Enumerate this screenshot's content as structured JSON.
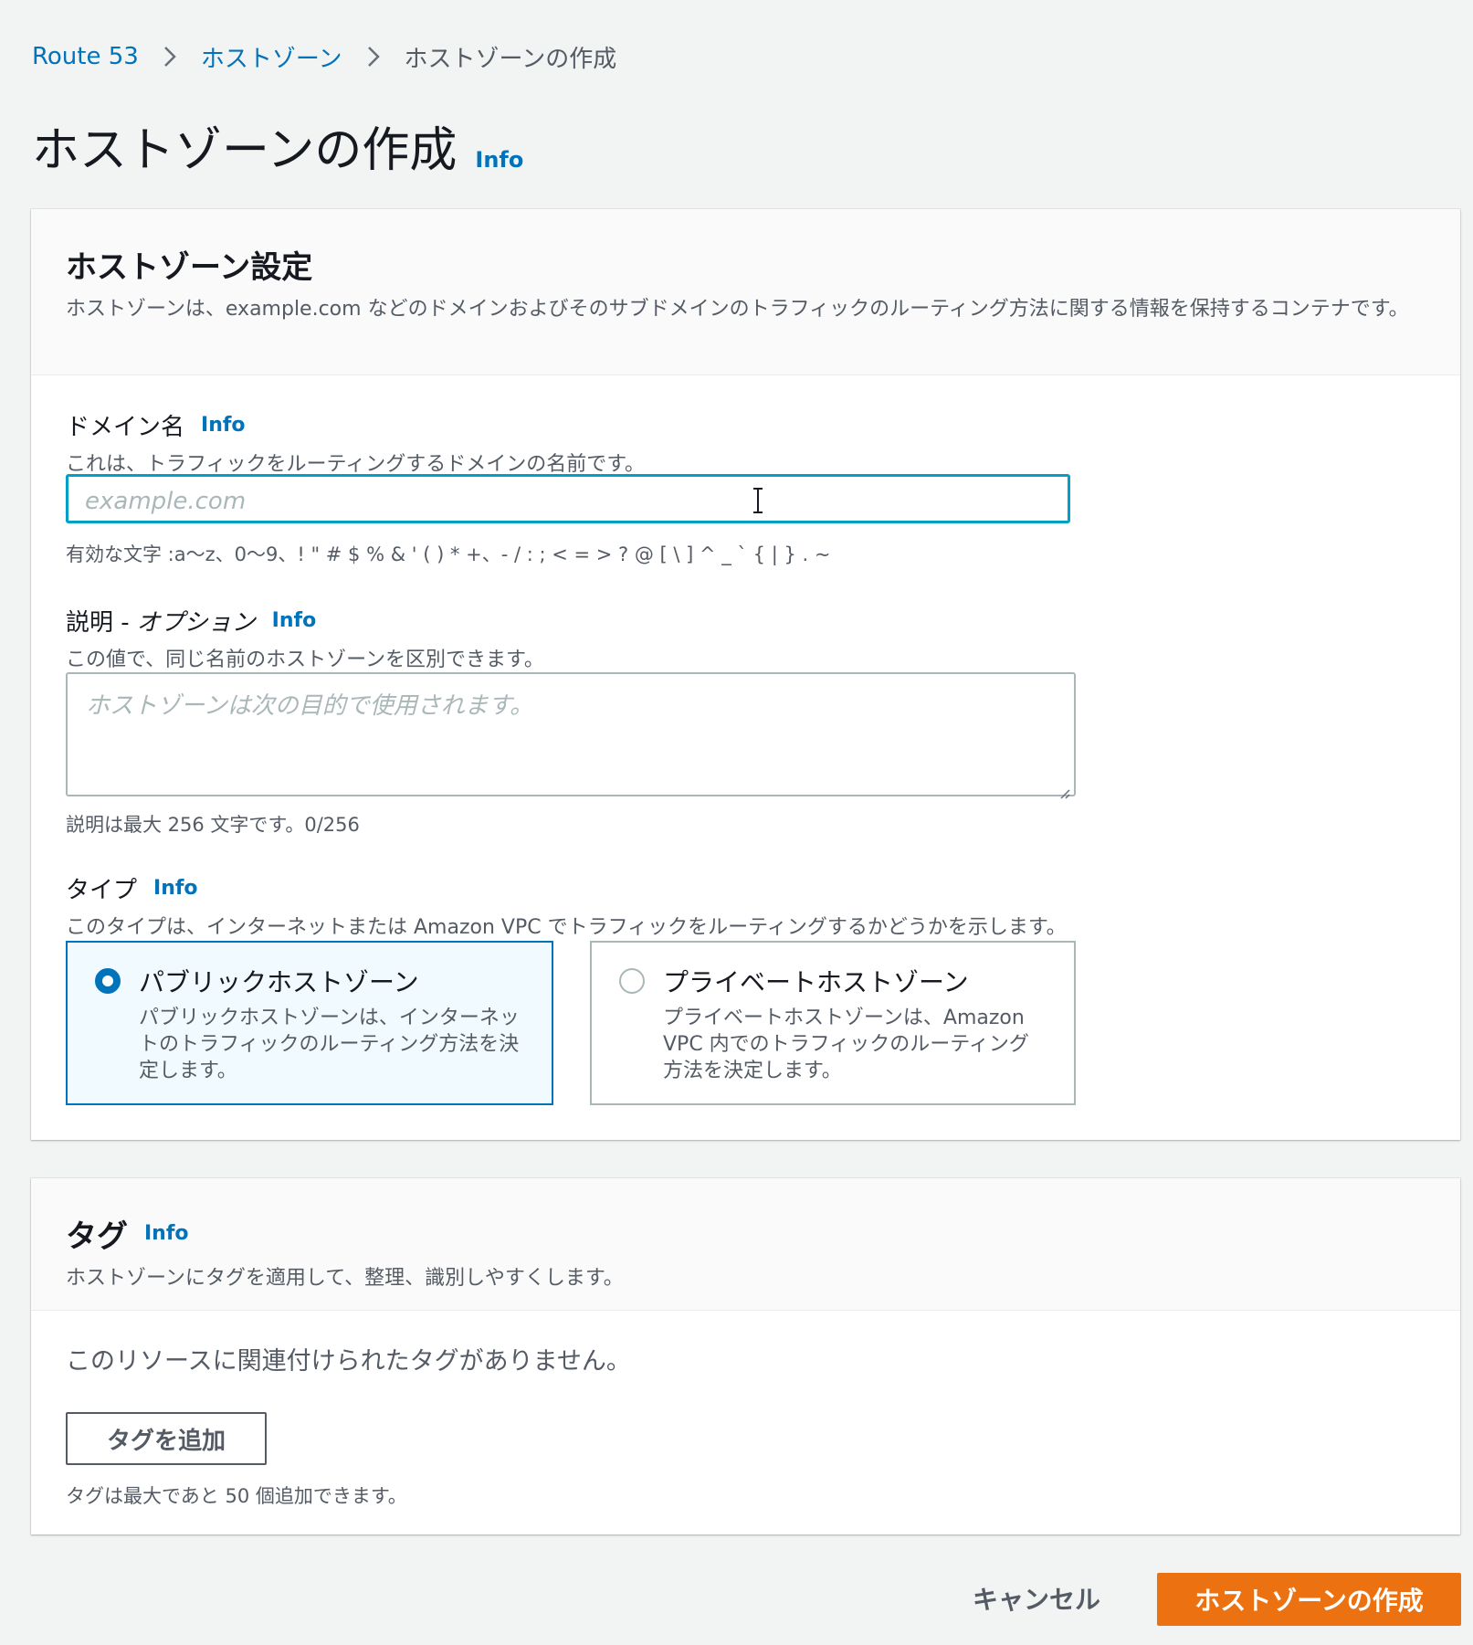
{
  "breadcrumb": {
    "items": [
      "Route 53",
      "ホストゾーン"
    ],
    "current": "ホストゾーンの作成"
  },
  "page": {
    "title": "ホストゾーンの作成",
    "info": "Info"
  },
  "settings": {
    "title": "ホストゾーン設定",
    "description": "ホストゾーンは、example.com などのドメインおよびそのサブドメインのトラフィックのルーティング方法に関する情報を保持するコンテナです。",
    "domain": {
      "label": "ドメイン名",
      "info": "Info",
      "description": "これは、トラフィックをルーティングするドメインの名前です。",
      "placeholder": "example.com",
      "value": "",
      "hint": "有効な文字 :a〜z、0〜9、! \" # $ % & ' ( ) * +、- / : ; < = > ? @ [ \\ ] ^ _ ` { | } . ~"
    },
    "desc_field": {
      "label": "説明 - ",
      "label_optional": "オプション",
      "info": "Info",
      "description": "この値で、同じ名前のホストゾーンを区別できます。",
      "placeholder": "ホストゾーンは次の目的で使用されます。",
      "hint": "説明は最大 256 文字です。0/256"
    },
    "type": {
      "label": "タイプ",
      "info": "Info",
      "description": "このタイプは、インターネットまたは Amazon VPC でトラフィックをルーティングするかどうかを示します。",
      "options": [
        {
          "title": "パブリックホストゾーン",
          "description": "パブリックホストゾーンは、インターネットのトラフィックのルーティング方法を決定します。",
          "selected": true
        },
        {
          "title": "プライベートホストゾーン",
          "description": "プライベートホストゾーンは、Amazon VPC 内でのトラフィックのルーティング方法を決定します。",
          "selected": false
        }
      ]
    }
  },
  "tags": {
    "title": "タグ",
    "info": "Info",
    "description": "ホストゾーンにタグを適用して、整理、識別しやすくします。",
    "empty": "このリソースに関連付けられたタグがありません。",
    "add_button": "タグを追加",
    "hint": "タグは最大であと 50 個追加できます。"
  },
  "actions": {
    "cancel": "キャンセル",
    "create": "ホストゾーンの作成"
  },
  "colors": {
    "link": "#0073bb",
    "primary": "#ec7211",
    "focus": "#00a1c9",
    "background": "#f2f3f3"
  }
}
